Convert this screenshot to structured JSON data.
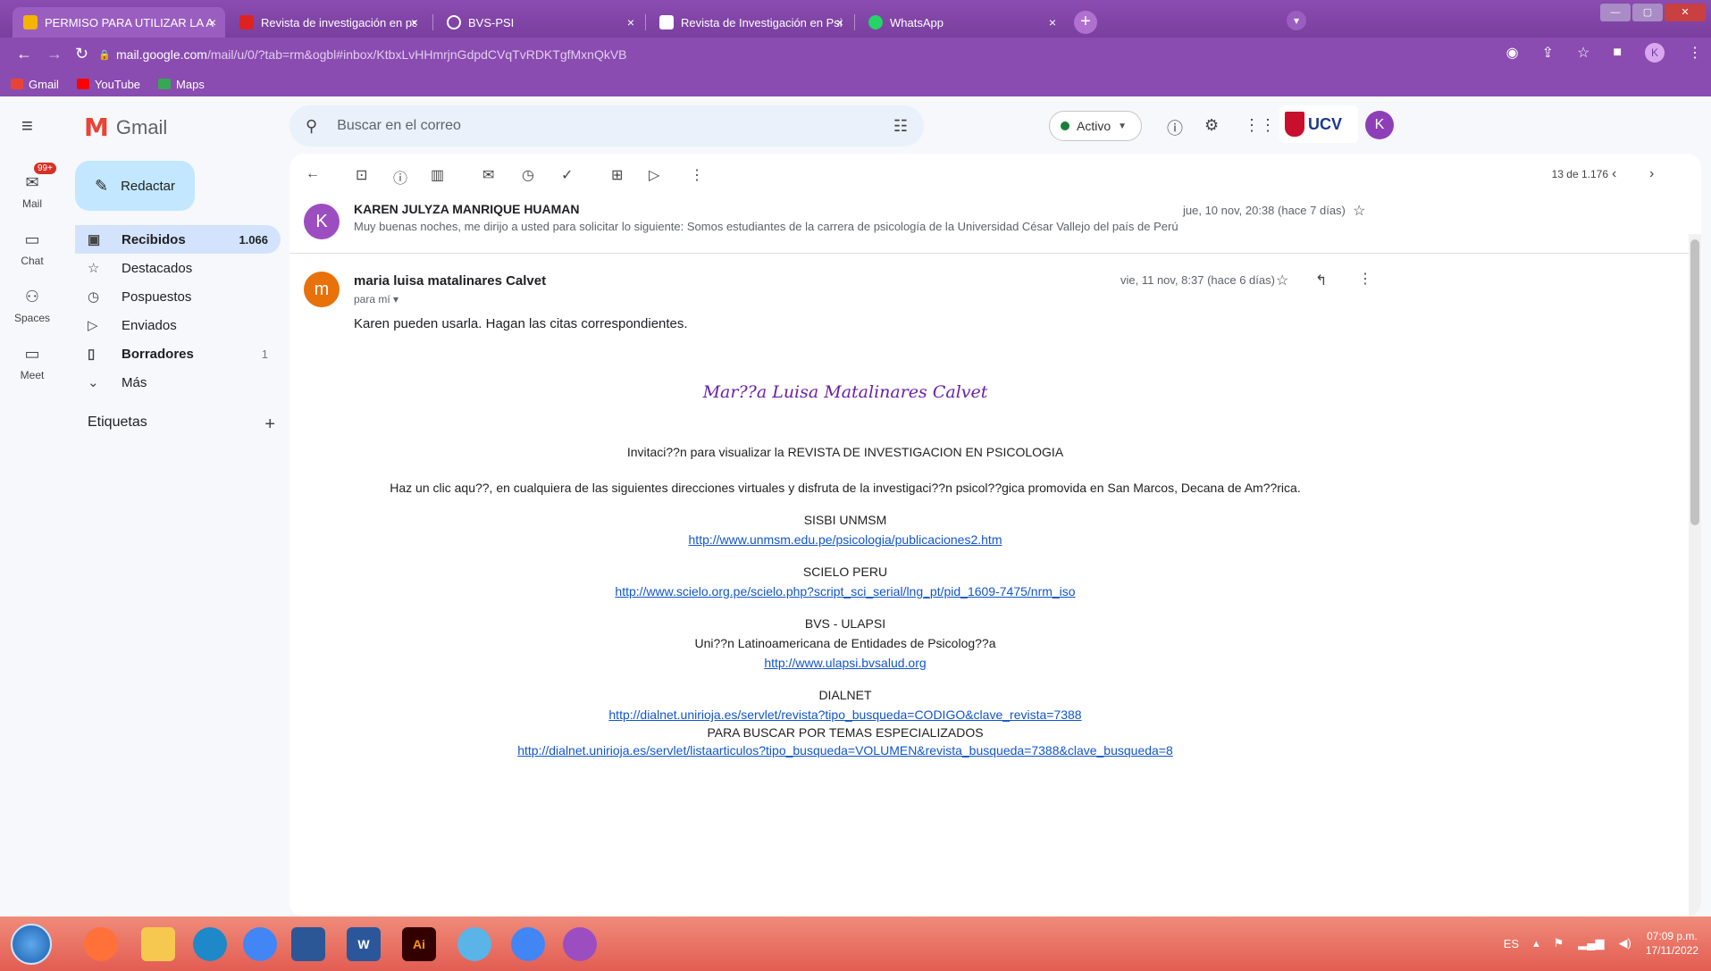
{
  "browser": {
    "tabs": [
      {
        "title": "PERMISO PARA UTILIZAR LA ADA",
        "active": true
      },
      {
        "title": "Revista de investigación en psico",
        "active": false
      },
      {
        "title": "BVS-PSI",
        "active": false
      },
      {
        "title": "Revista de Investigación en Psico",
        "active": false
      },
      {
        "title": "WhatsApp",
        "active": false
      }
    ],
    "tab_close": "×",
    "new_tab": "+",
    "url_host": "mail.google.com",
    "url_rest": "/mail/u/0/?tab=rm&ogbl#inbox/KtbxLvHHmrjnGdpdCVqTvRDKTgfMxnQkVB",
    "profile_initial": "K",
    "bookmarks": [
      "Gmail",
      "YouTube",
      "Maps"
    ]
  },
  "gmail": {
    "logo_letter": "M",
    "logo_text": "Gmail",
    "search_placeholder": "Buscar en el correo",
    "status": "Activo",
    "org_logo": "UCV",
    "account_initial": "K",
    "rail": {
      "mail_label": "Mail",
      "mail_badge": "99+",
      "chat_label": "Chat",
      "spaces_label": "Spaces",
      "meet_label": "Meet"
    },
    "compose_label": "Redactar",
    "nav": [
      {
        "label": "Recibidos",
        "count": "1.066"
      },
      {
        "label": "Destacados",
        "count": ""
      },
      {
        "label": "Pospuestos",
        "count": ""
      },
      {
        "label": "Enviados",
        "count": ""
      },
      {
        "label": "Borradores",
        "count": "1"
      },
      {
        "label": "Más",
        "count": ""
      }
    ],
    "labels_title": "Etiquetas",
    "labels_add": "+"
  },
  "thread": {
    "pager": "13 de 1.176",
    "messages": [
      {
        "initial": "K",
        "sender": "KAREN JULYZA MANRIQUE HUAMAN",
        "snippet": "Muy buenas noches, me dirijo a usted para solicitar lo siguiente: Somos estudiantes de la carrera de psicología de la Universidad César Vallejo del país de Perú",
        "date": "jue, 10 nov, 20:38 (hace 7 días)"
      },
      {
        "initial": "m",
        "sender": "maria luisa matalinares Calvet",
        "to": "para mí",
        "date": "vie, 11 nov, 8:37 (hace 6 días)",
        "body": "Karen pueden usarla. Hagan las citas correspondientes."
      }
    ],
    "signature": "Mar??a Luisa Matalinares Calvet",
    "invitation": "Invitaci??n para visualizar la REVISTA DE INVESTIGACION EN PSICOLOGIA",
    "click_here": "Haz un clic aqu??,  en cualquiera de las siguientes direcciones virtuales y disfruta de la investigaci??n psicol??gica promovida en San Marcos, Decana de Am??rica.",
    "sisbi_title": "SISBI UNMSM",
    "sisbi_link": "http://www.unmsm.edu.pe/psicologia/publicaciones2.htm",
    "scielo_title": "SCIELO PERU",
    "scielo_link": "http://www.scielo.org.pe/scielo.php?script_sci_serial/lng_pt/pid_1609-7475/nrm_iso",
    "bvs_title": "BVS - ULAPSI",
    "bvs_sub": "Uni??n Latinoamericana de Entidades de Psicolog??a",
    "bvs_link": "http://www.ulapsi.bvsalud.org",
    "dialnet_title": "DIALNET",
    "dialnet_link": "http://dialnet.unirioja.es/servlet/revista?tipo_busqueda=CODIGO&clave_revista=7388",
    "dialnet_sub": "PARA BUSCAR POR TEMAS ESPECIALIZADOS",
    "dialnet_link2": "http://dialnet.unirioja.es/servlet/listaarticulos?tipo_busqueda=VOLUMEN&revista_busqueda=7388&clave_busqueda=8"
  },
  "taskbar": {
    "word_label": "W",
    "ai_label": "Ai",
    "lang": "ES",
    "time": "07:09 p.m.",
    "date": "17/11/2022"
  },
  "colors": {
    "browser_frame": "#7b3fa0",
    "compose_bg": "#c2e7ff",
    "inbox_active": "#d3e3fd",
    "link": "#1155cc",
    "signature": "#6a1fa8",
    "taskbar": "#e25d52"
  }
}
